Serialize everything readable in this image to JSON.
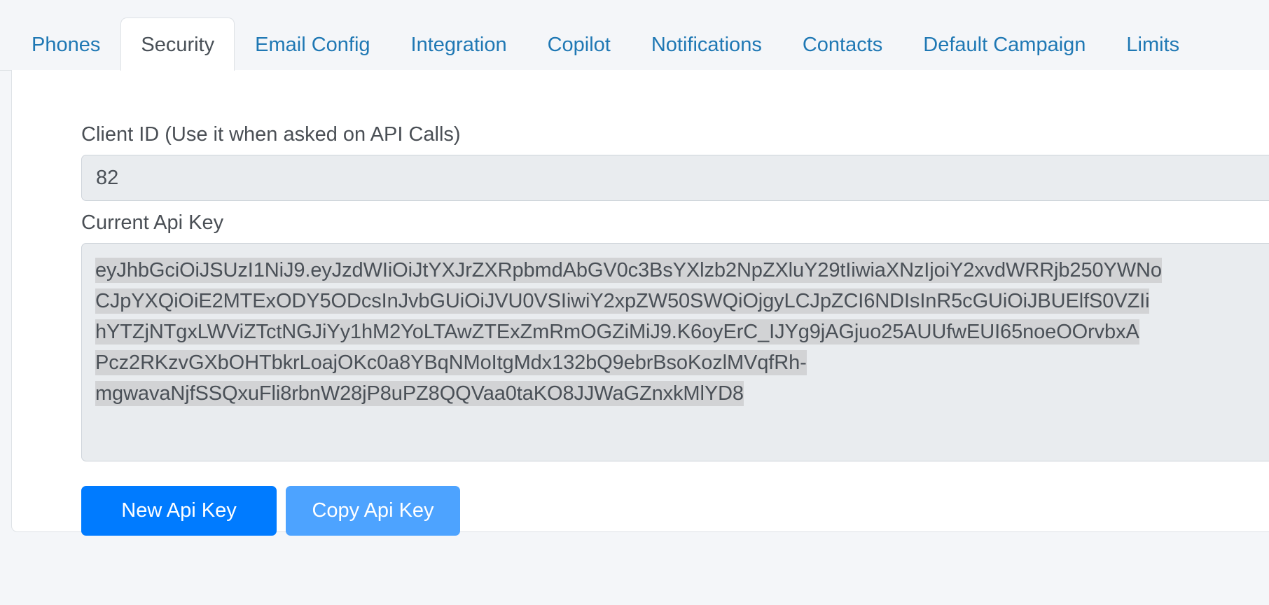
{
  "tabs": [
    {
      "label": "Phones",
      "active": false
    },
    {
      "label": "Security",
      "active": true
    },
    {
      "label": "Email Config",
      "active": false
    },
    {
      "label": "Integration",
      "active": false
    },
    {
      "label": "Copilot",
      "active": false
    },
    {
      "label": "Notifications",
      "active": false
    },
    {
      "label": "Contacts",
      "active": false
    },
    {
      "label": "Default Campaign",
      "active": false
    },
    {
      "label": "Limits",
      "active": false
    }
  ],
  "security": {
    "client_id_label": "Client ID (Use it when asked on API Calls)",
    "client_id_value": "82",
    "api_key_label": "Current Api Key",
    "api_key_lines": [
      "eyJhbGciOiJSUzI1NiJ9.eyJzdWIiOiJtYXJrZXRpbmdAbGV0c3BsYXlzb2NpZXluY29tIiwiaXNzIjoiY2xvdWRRjb250YWNo",
      "CJpYXQiOiE2MTExODY5ODcsInJvbGUiOiJVU0VSIiwiY2xpZW50SWQiOjgyLCJpZCI6NDIsInR5cGUiOiJBUElfS0VZIi",
      "hYTZjNTgxLWViZTctNGJiYy1hM2YoLTAwZTExZmRmOGZiMiJ9.K6oyErC_IJYg9jAGjuo25AUUfwEUI65noeOOrvbxA",
      "Pcz2RKzvGXbOHTbkrLoajOKc0a8YBqNMoItgMdx132bQ9ebrBsoKozlMVqfRh-",
      "mgwavaNjfSSQxuFli8rbnW28jP8uPZ8QQVaa0taKO8JJWaGZnxkMlYD8"
    ],
    "new_api_key_label": "New Api Key",
    "copy_api_key_label": "Copy Api Key"
  },
  "colors": {
    "page_background": "#f4f6f9",
    "card_background": "#ffffff",
    "tab_link": "#1f78b4",
    "tab_active_text": "#495057",
    "input_background": "#e9ecef",
    "input_border": "#ced4da",
    "selection_highlight": "#d2d3d5",
    "primary_button": "#007bff",
    "info_button": "#4da3ff",
    "text": "#4a5057"
  }
}
